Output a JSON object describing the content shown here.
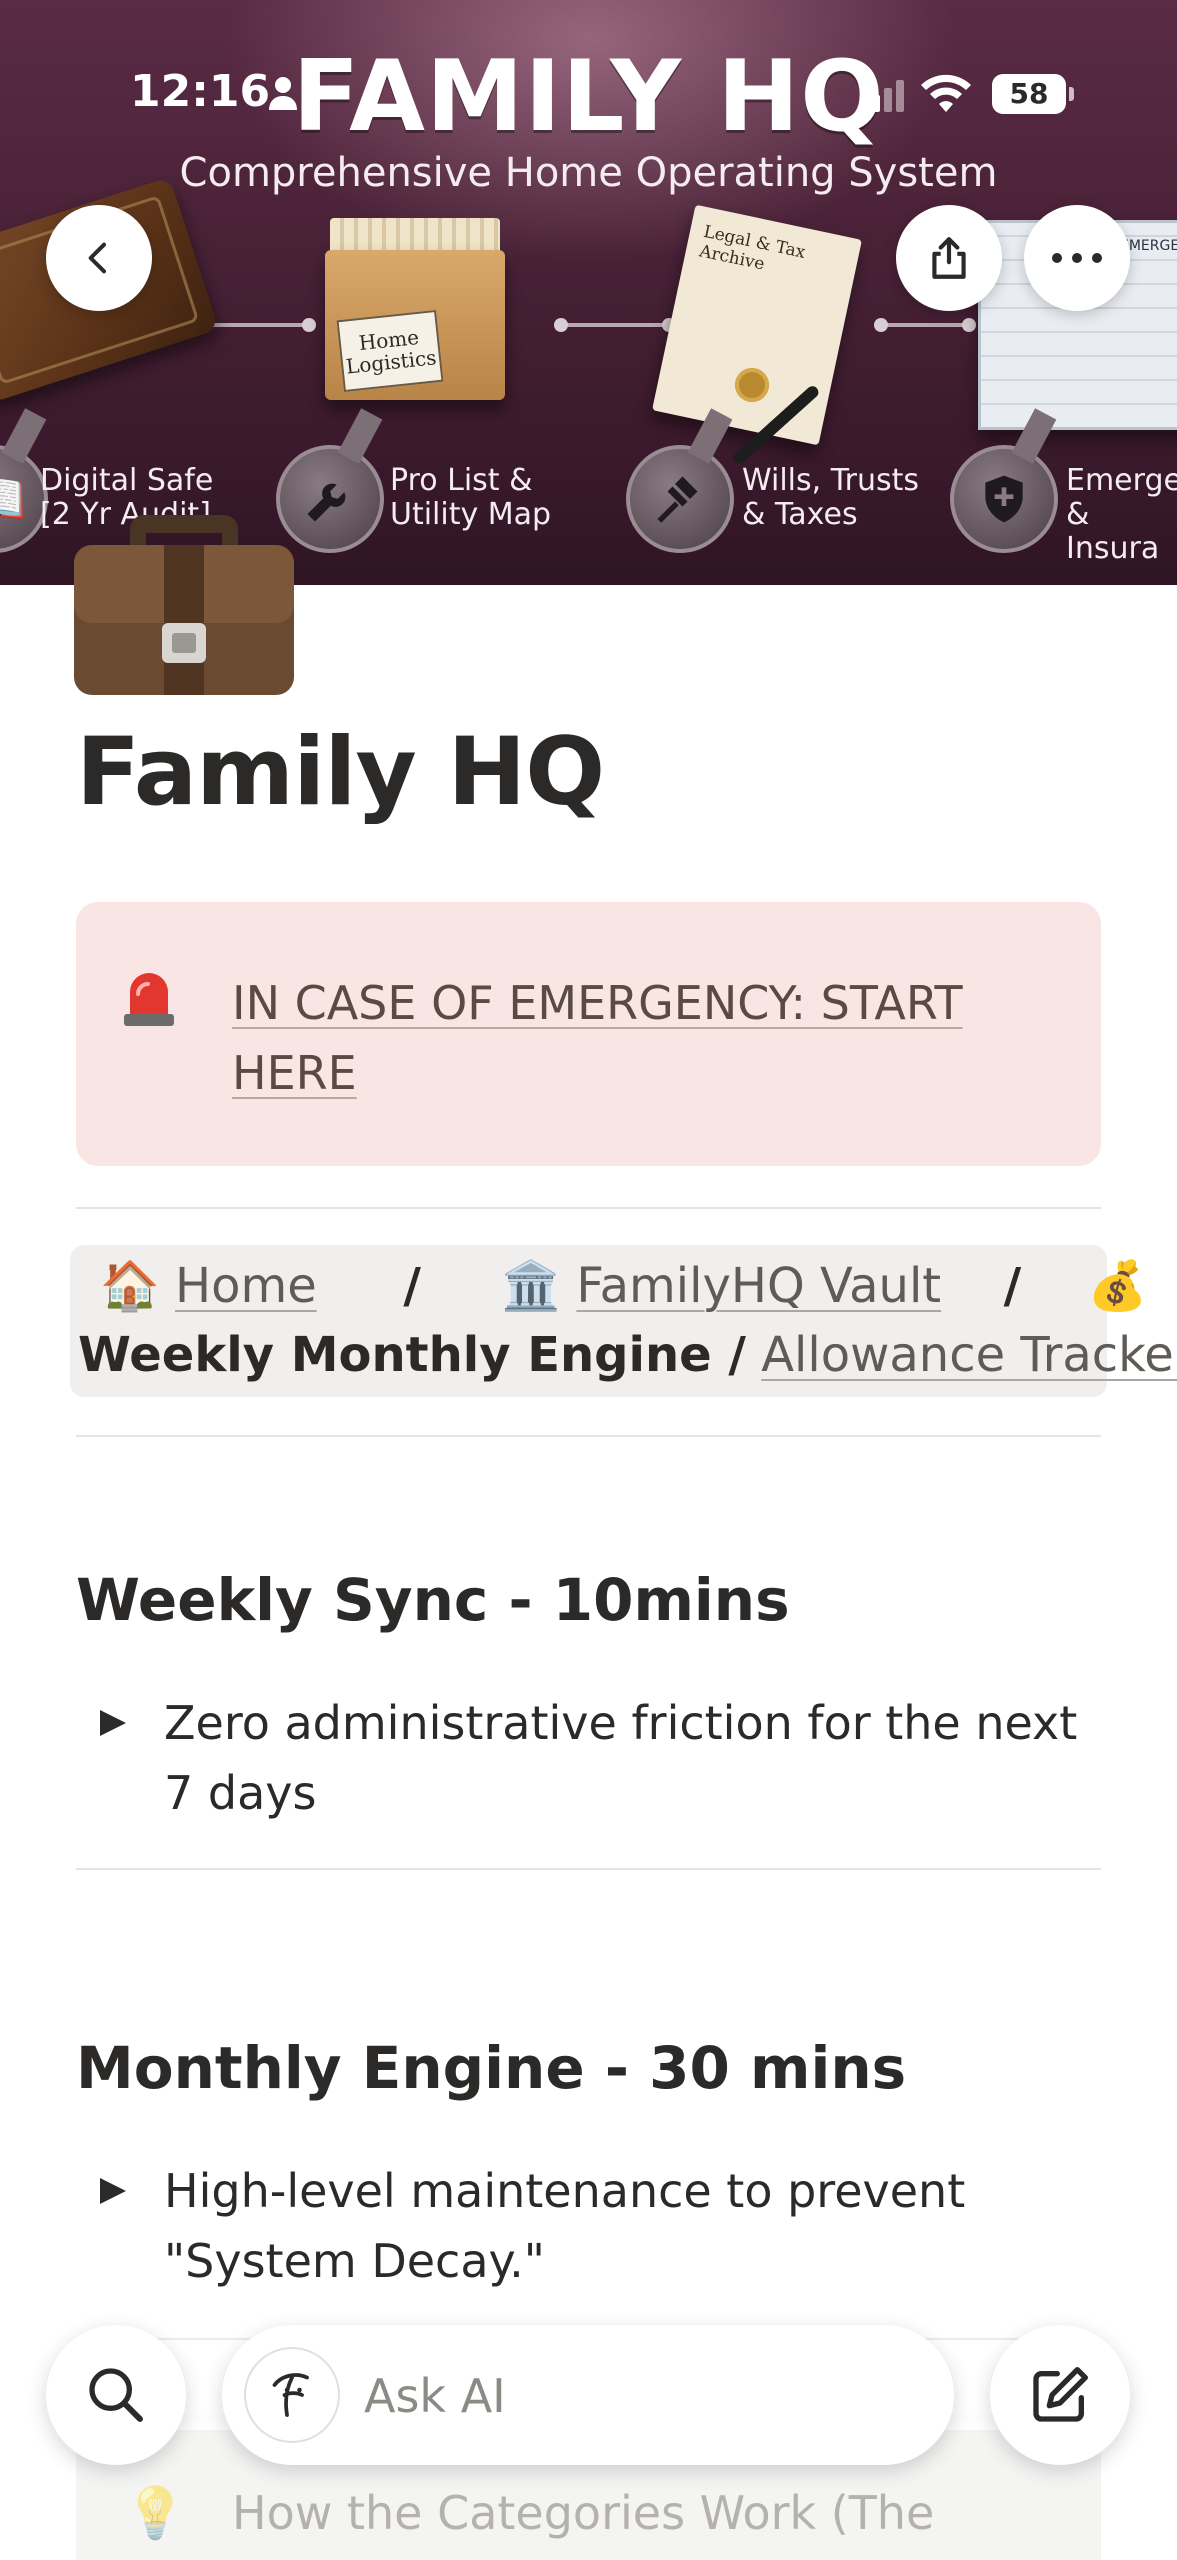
{
  "status_bar": {
    "time": "12:16",
    "battery": "58",
    "icons": [
      "person-icon",
      "signal-icon",
      "wifi-icon",
      "battery-icon"
    ]
  },
  "cover": {
    "title": "FAMILY HQ",
    "subtitle": "Comprehensive Home Operating System",
    "box_label": "Home Logistics",
    "paper_title": "Legal & Tax Archive",
    "blueprint_title": "EMERGENC",
    "badges": [
      {
        "icon": "book-icon",
        "label_line1": "Digital Safe",
        "label_line2": "[2 Yr Audit]"
      },
      {
        "icon": "tools-icon",
        "label_line1": "Pro List &",
        "label_line2": "Utility Map"
      },
      {
        "icon": "gavel-icon",
        "label_line1": "Wills, Trusts",
        "label_line2": "& Taxes"
      },
      {
        "icon": "medical-shield-icon",
        "label_line1": "Emerge",
        "label_line2": "& Insura"
      }
    ]
  },
  "nav": {
    "back_icon": "chevron-left-icon",
    "share_icon": "share-icon",
    "more_icon": "more-horizontal-icon"
  },
  "page": {
    "icon": "briefcase-icon",
    "title": "Family HQ"
  },
  "callout": {
    "icon": "siren-icon",
    "link_text": "IN CASE OF EMERGENCY: START HERE"
  },
  "breadcrumb": {
    "home_emoji": "🏠",
    "home": "Home",
    "sep": "/",
    "vault_emoji": "🏛️",
    "vault": "FamilyHQ Vault",
    "engine_emoji": "💰",
    "engine": "Weekly  Monthly Engine /",
    "tracker": "Allowance Tracker"
  },
  "sections": [
    {
      "heading": "Weekly Sync - 10mins",
      "toggle_text": "Zero administrative friction for the next 7 days"
    },
    {
      "heading": "Monthly Engine - 30 mins",
      "toggle_text": "High-level maintenance to prevent \"System Decay.\""
    }
  ],
  "hidden_callout": {
    "icon": "lightbulb-icon",
    "text": "How the Categories Work (The"
  },
  "bottom_bar": {
    "search_icon": "search-icon",
    "ai_icon": "ai-face-icon",
    "ask_placeholder": "Ask AI",
    "compose_icon": "compose-icon"
  },
  "colors": {
    "callout_bg": "#f9e6e4",
    "breadcrumb_bg": "#f0efed",
    "cover_bg": "#4a2238",
    "text": "#2b2a28"
  }
}
